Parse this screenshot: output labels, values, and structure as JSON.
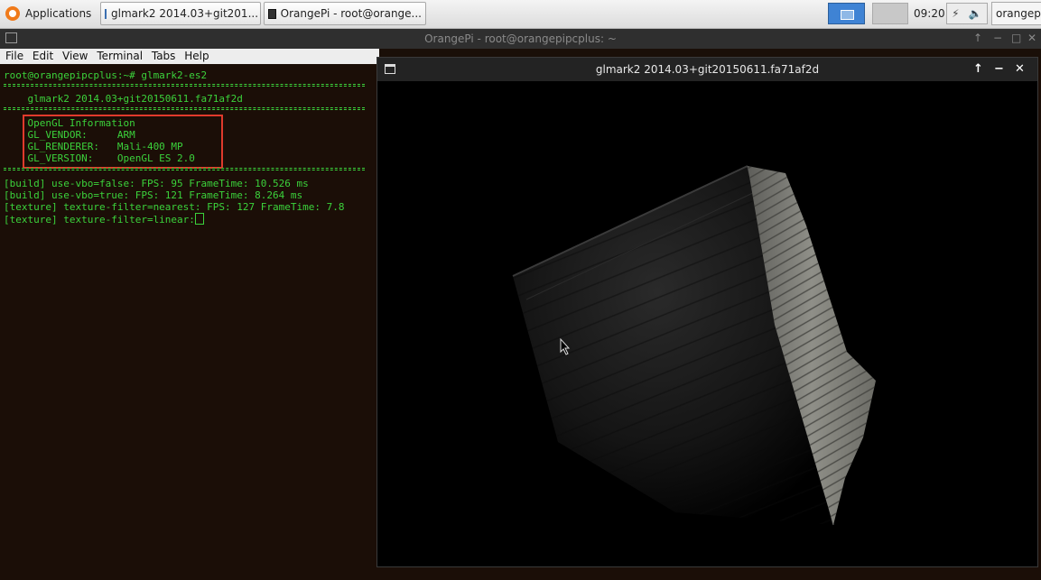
{
  "panel": {
    "applications_label": "Applications",
    "task1_label": "glmark2 2014.03+git201...",
    "task2_label": "OrangePi - root@orange...",
    "clock": "09:20",
    "user_label": "orangepi"
  },
  "terminal": {
    "title": "OrangePi - root@orangepipcplus: ~",
    "controls": {
      "up": "↑",
      "min": "−",
      "max": "□",
      "close": "✕"
    },
    "menu": [
      "File",
      "Edit",
      "View",
      "Terminal",
      "Tabs",
      "Help"
    ],
    "lines": {
      "prompt": "root@orangepipcplus:~# glmark2-es2",
      "banner": "    glmark2 2014.03+git20150611.fa71af2d",
      "info_header": "    OpenGL Information",
      "vendor": "    GL_VENDOR:     ARM",
      "renderer": "    GL_RENDERER:   Mali-400 MP",
      "version": "    GL_VERSION:    OpenGL ES 2.0",
      "result1": "[build] use-vbo=false: FPS: 95 FrameTime: 10.526 ms",
      "result2": "[build] use-vbo=true: FPS: 121 FrameTime: 8.264 ms",
      "result3": "[texture] texture-filter=nearest: FPS: 127 FrameTime: 7.8",
      "result4": "[texture] texture-filter=linear:"
    }
  },
  "glwindow": {
    "title": "glmark2 2014.03+git20150611.fa71af2d",
    "controls": {
      "up": "↑",
      "min": "−",
      "close": "✕"
    }
  },
  "icons": {
    "applications": "applications-icon",
    "task1": "window-icon",
    "task2": "terminal-icon",
    "pointer": "mouse-pointer-icon"
  },
  "colors": {
    "terminal_text": "#3bd23b",
    "highlight_box": "#e03a2c",
    "workspace_active": "#3f83d4"
  }
}
